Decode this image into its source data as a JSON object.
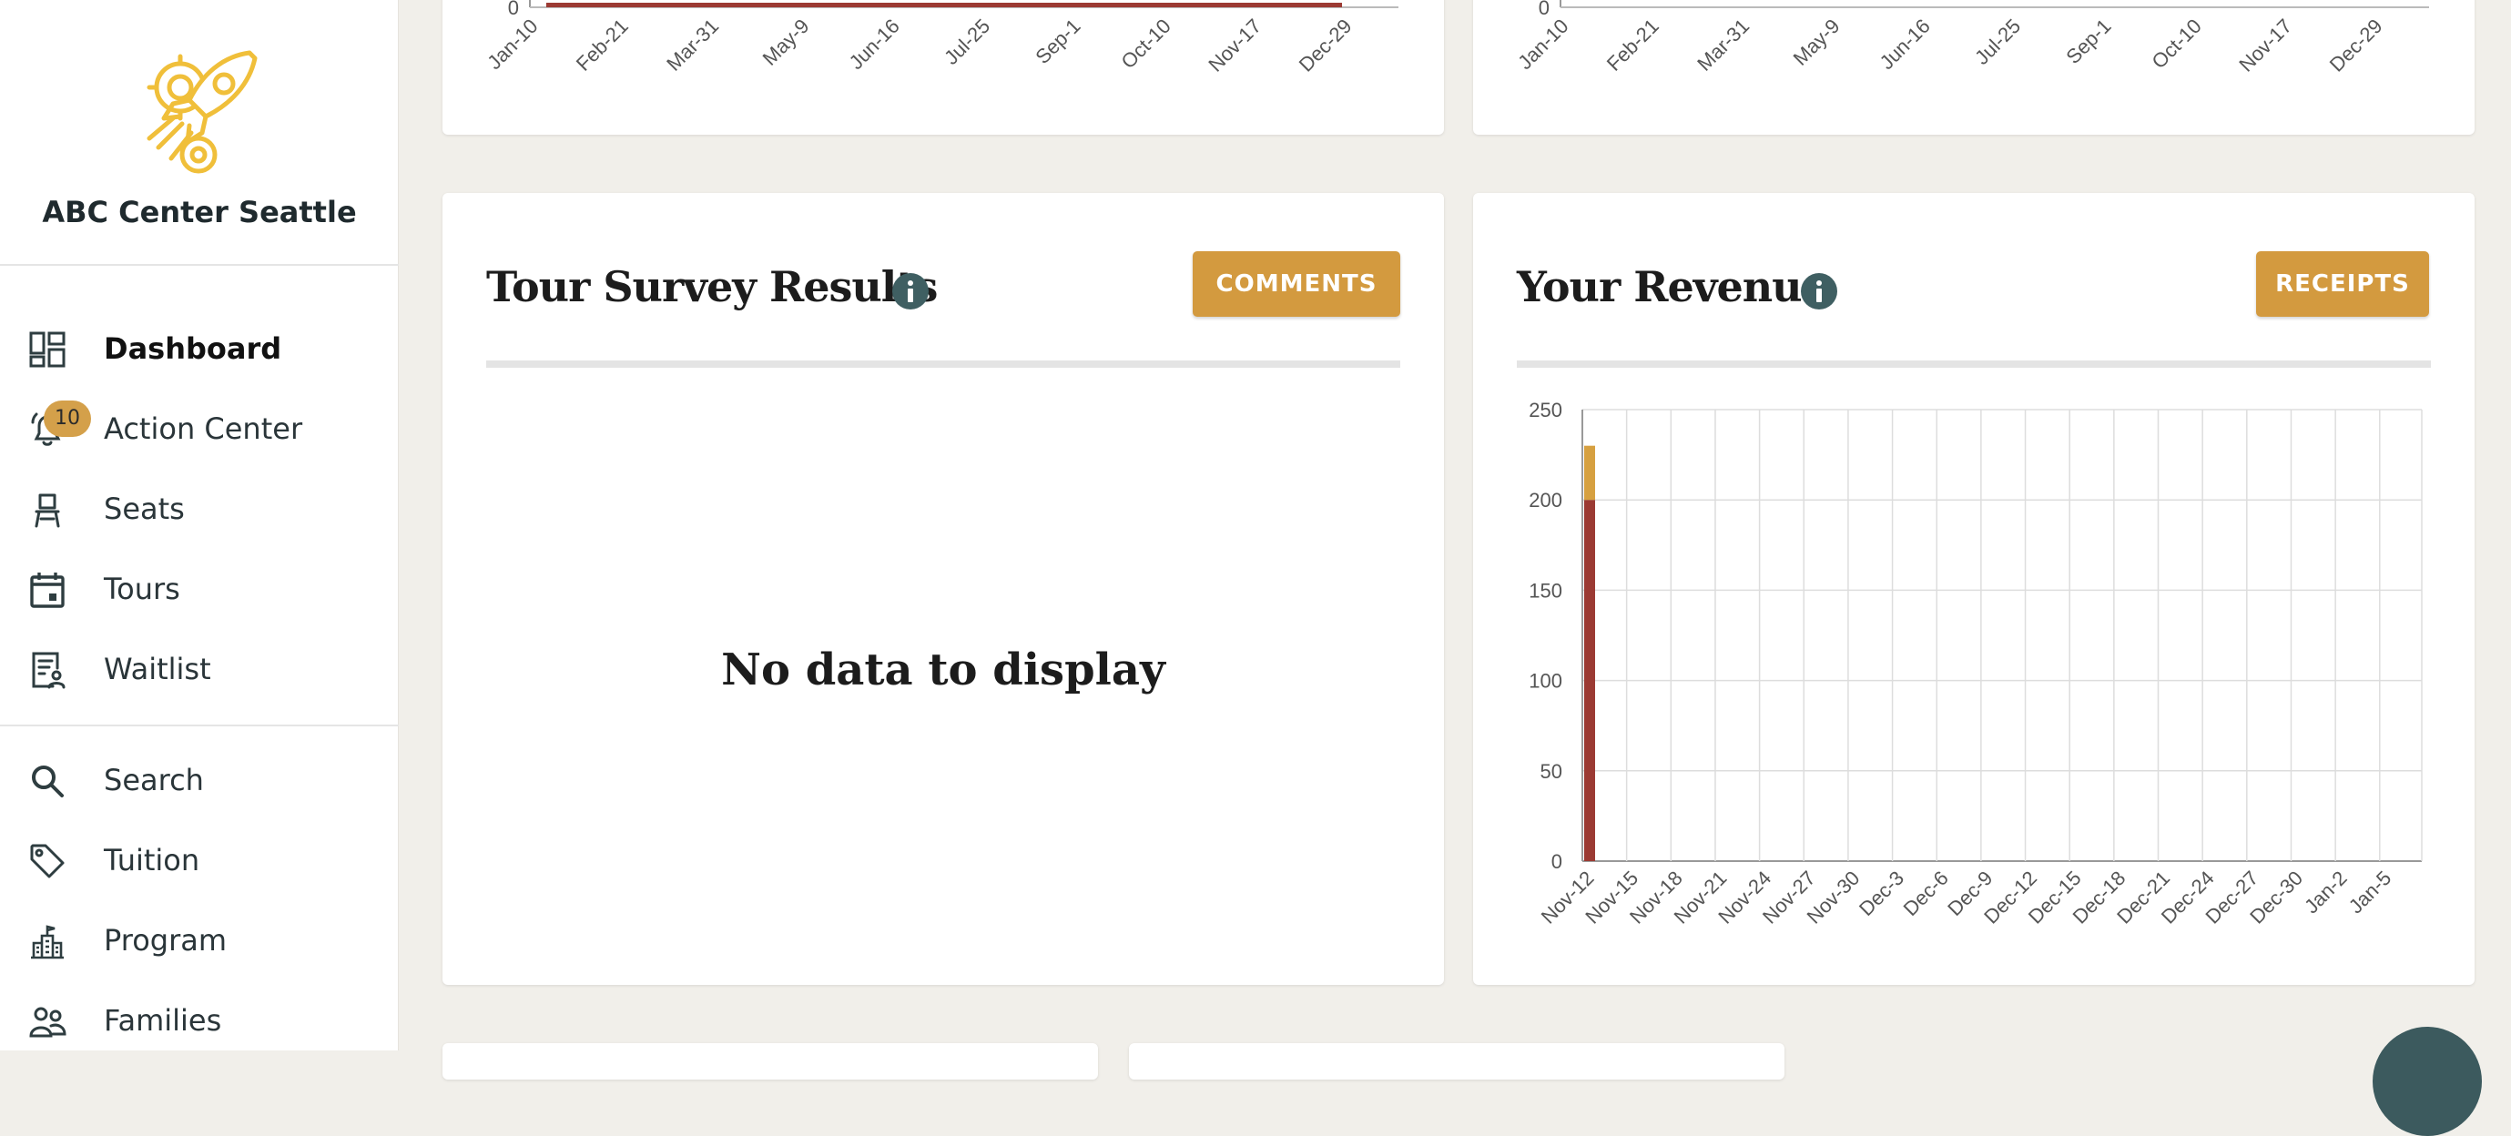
{
  "org": {
    "name": "ABC Center Seattle"
  },
  "nav": [
    {
      "label": "Dashboard",
      "icon": "dashboard-icon",
      "active": true
    },
    {
      "label": "Action Center",
      "icon": "bell-icon",
      "badge": "10"
    },
    {
      "label": "Seats",
      "icon": "chair-icon"
    },
    {
      "label": "Tours",
      "icon": "calendar-icon"
    },
    {
      "label": "Waitlist",
      "icon": "waitlist-icon"
    },
    {
      "label": "Search",
      "icon": "search-icon"
    },
    {
      "label": "Tuition",
      "icon": "tag-icon"
    },
    {
      "label": "Program",
      "icon": "building-icon"
    },
    {
      "label": "Families",
      "icon": "people-icon"
    }
  ],
  "top_charts": {
    "x_labels": [
      "Jan-10",
      "Feb-21",
      "Mar-31",
      "May-9",
      "Jun-16",
      "Jul-25",
      "Sep-1",
      "Oct-10",
      "Nov-17",
      "Dec-29"
    ],
    "y_zero": "0"
  },
  "survey": {
    "title": "Tour Survey Results",
    "button": "COMMENTS",
    "empty": "No data to display"
  },
  "revenue": {
    "title": "Your Revenue",
    "button": "RECEIPTS"
  },
  "colors": {
    "bar_primary": "#9b3a33",
    "bar_secondary": "#d6a040",
    "accent_button": "#d39a3f",
    "info_icon": "#3f5f62"
  },
  "chart_data": {
    "type": "bar",
    "stacked": true,
    "categories": [
      "Nov-12",
      "Nov-15",
      "Nov-18",
      "Nov-21",
      "Nov-24",
      "Nov-27",
      "Nov-30",
      "Dec-3",
      "Dec-6",
      "Dec-9",
      "Dec-12",
      "Dec-15",
      "Dec-18",
      "Dec-21",
      "Dec-24",
      "Dec-27",
      "Dec-30",
      "Jan-2",
      "Jan-5"
    ],
    "series": [
      {
        "values": [
          200,
          0,
          0,
          0,
          0,
          0,
          0,
          0,
          0,
          0,
          0,
          0,
          0,
          0,
          0,
          0,
          0,
          0,
          0
        ]
      },
      {
        "values": [
          30,
          0,
          0,
          0,
          0,
          0,
          0,
          0,
          0,
          0,
          0,
          0,
          0,
          0,
          0,
          0,
          0,
          0,
          0
        ]
      }
    ],
    "y_ticks": [
      0,
      50,
      100,
      150,
      200,
      250
    ],
    "ylim": [
      0,
      250
    ],
    "grid": true
  }
}
